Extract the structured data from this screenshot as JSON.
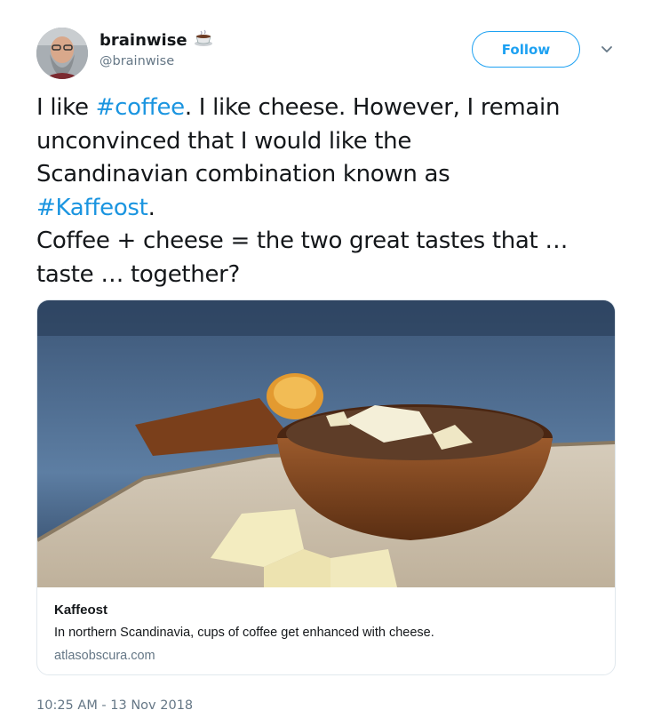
{
  "user": {
    "display_name": "brainwise",
    "handle": "@brainwise",
    "name_emoji": "coffee-cup-icon"
  },
  "header": {
    "follow_label": "Follow",
    "menu_icon": "chevron-down-icon"
  },
  "tweet": {
    "lines": [
      [
        {
          "text": "I like "
        },
        {
          "text": "#coffee",
          "hashtag": true
        },
        {
          "text": ". I like cheese. However, I remain"
        }
      ],
      [
        {
          "text": "unconvinced that I would like the"
        }
      ],
      [
        {
          "text": "Scandinavian combination known as"
        }
      ],
      [
        {
          "text": "#Kaffeost",
          "hashtag": true
        },
        {
          "text": "."
        }
      ],
      [
        {
          "text": "Coffee + cheese = the two great tastes that …"
        }
      ],
      [
        {
          "text": "taste … together?"
        }
      ]
    ]
  },
  "card": {
    "title": "Kaffeost",
    "description": "In northern Scandinavia, cups of coffee get enhanced with cheese.",
    "domain": "atlasobscura.com"
  },
  "timestamp": "10:25 AM - 13 Nov 2018",
  "colors": {
    "accent": "#1da1f2",
    "hashtag": "#1b95e0",
    "secondary_text": "#657786"
  }
}
